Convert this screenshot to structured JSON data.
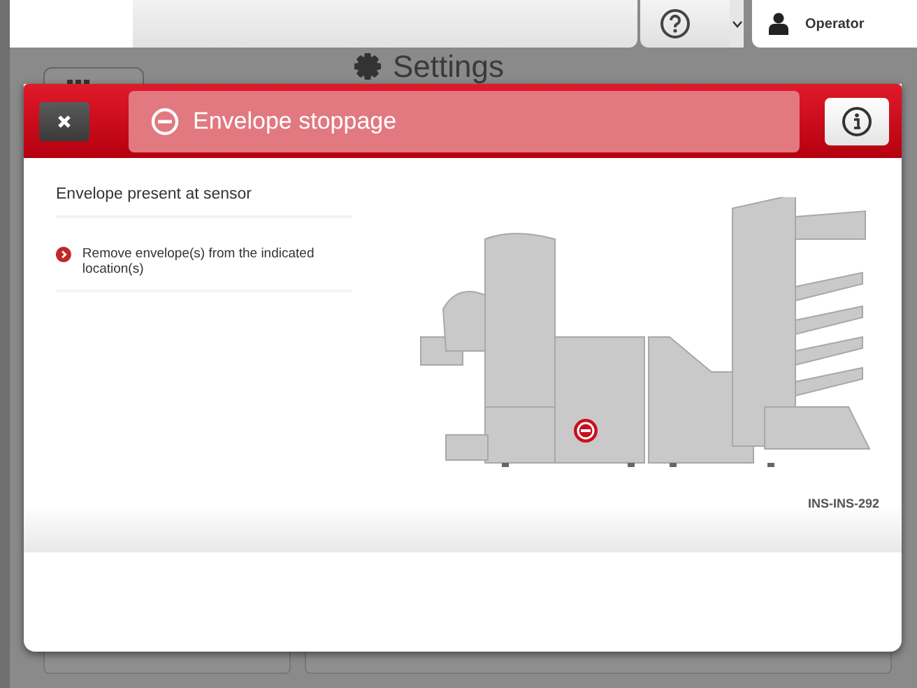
{
  "top_bar": {
    "user": {
      "name": "Operator"
    }
  },
  "background": {
    "title": "Settings"
  },
  "dialog": {
    "title": "Envelope stoppage",
    "message": "Envelope present at sensor",
    "steps": [
      {
        "text": "Remove envelope(s) from the indicated location(s)"
      }
    ],
    "image_caption": "INS-INS-292"
  }
}
